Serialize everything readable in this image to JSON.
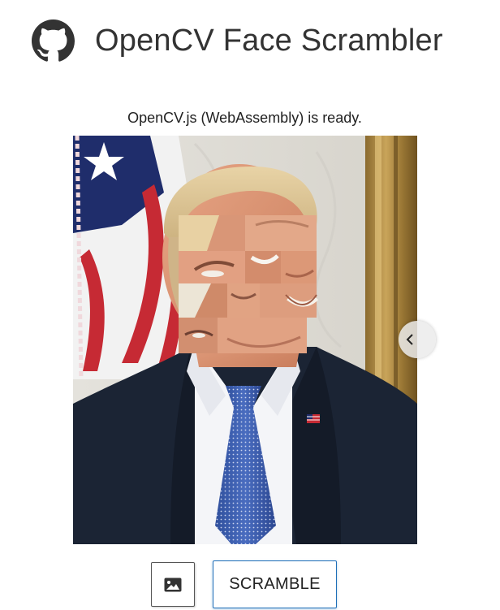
{
  "header": {
    "title": "OpenCV Face Scrambler",
    "github_icon": "github-icon"
  },
  "status": {
    "text": "OpenCV.js (WebAssembly) is ready."
  },
  "image": {
    "content": "portrait-with-scrambled-face-tiles"
  },
  "side_handle": {
    "icon": "chevron-left-icon"
  },
  "controls": {
    "image_button_icon": "image-icon",
    "scramble_label": "SCRAMBLE"
  },
  "colors": {
    "title_text": "#333333",
    "scramble_border": "#1f6fb8"
  }
}
